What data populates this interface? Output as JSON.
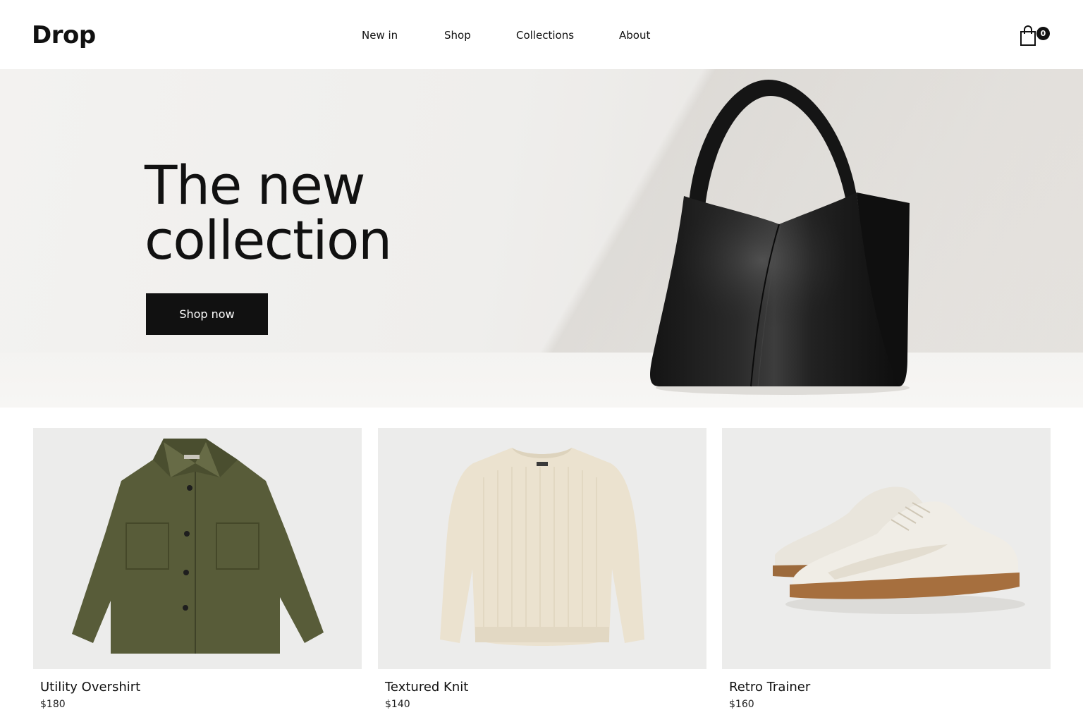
{
  "header": {
    "logo": "Drop",
    "nav": [
      "New in",
      "Shop",
      "Collections",
      "About"
    ],
    "cart_icon": "shopping-bag-icon",
    "cart_count": "0"
  },
  "hero": {
    "title": "The new collection",
    "cta_label": "Shop now",
    "image": "black-leather-tote-bag"
  },
  "products": [
    {
      "name": "Utility Overshirt",
      "price": "$180",
      "image": "olive-overshirt",
      "color": "#5a5e3c"
    },
    {
      "name": "Textured Knit",
      "price": "$140",
      "image": "cream-knit-sweater",
      "color": "#ebe2cf"
    },
    {
      "name": "Retro Trainer",
      "price": "$160",
      "image": "white-gum-sole-sneakers",
      "color": "#eeeae2"
    }
  ],
  "colors": {
    "accent": "#111111",
    "background": "#ffffff",
    "card_bg": "#ececeb"
  }
}
